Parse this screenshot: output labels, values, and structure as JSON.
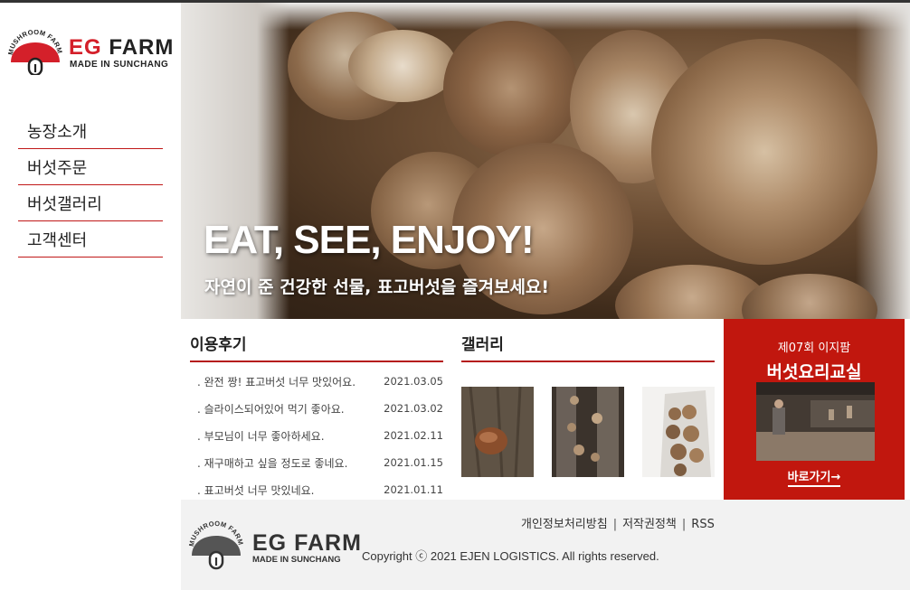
{
  "colors": {
    "accent": "#c1170e",
    "divider": "#b51a1a",
    "footer_bg": "#f2f2f2"
  },
  "logo": {
    "arc_text": "MUSHROOM FARM",
    "brand_eg": "EG",
    "brand_farm": "FARM",
    "tagline": "MADE IN SUNCHANG"
  },
  "nav": {
    "items": [
      {
        "label": "농장소개"
      },
      {
        "label": "버섯주문"
      },
      {
        "label": "버섯갤러리"
      },
      {
        "label": "고객센터"
      }
    ]
  },
  "hero": {
    "title": "EAT, SEE, ENJOY!",
    "subtitle": "자연이 준 건강한 선물, 표고버섯을 즐겨보세요!"
  },
  "reviews": {
    "title": "이용후기",
    "items": [
      {
        "text": ". 완전 짱! 표고버섯 너무 맛있어요.",
        "date": "2021.03.05"
      },
      {
        "text": ". 슬라이스되어있어 먹기 좋아요.",
        "date": "2021.03.02"
      },
      {
        "text": ". 부모님이 너무 좋아하세요.",
        "date": "2021.02.11"
      },
      {
        "text": ". 재구매하고 싶을 정도로 좋네요.",
        "date": "2021.01.15"
      },
      {
        "text": ". 표고버섯 너무 맛있네요.",
        "date": "2021.01.11"
      }
    ]
  },
  "gallery": {
    "title": "갤러리"
  },
  "cooking_class": {
    "subtitle": "제07회 이지팜",
    "title": "버섯요리교실",
    "link": "바로가기→"
  },
  "footer": {
    "links": [
      "개인정보처리방침",
      "저작권정책",
      "RSS"
    ],
    "separator": "|",
    "copyright": "Copyright ⓒ 2021 EJEN LOGISTICS. All rights reserved."
  }
}
